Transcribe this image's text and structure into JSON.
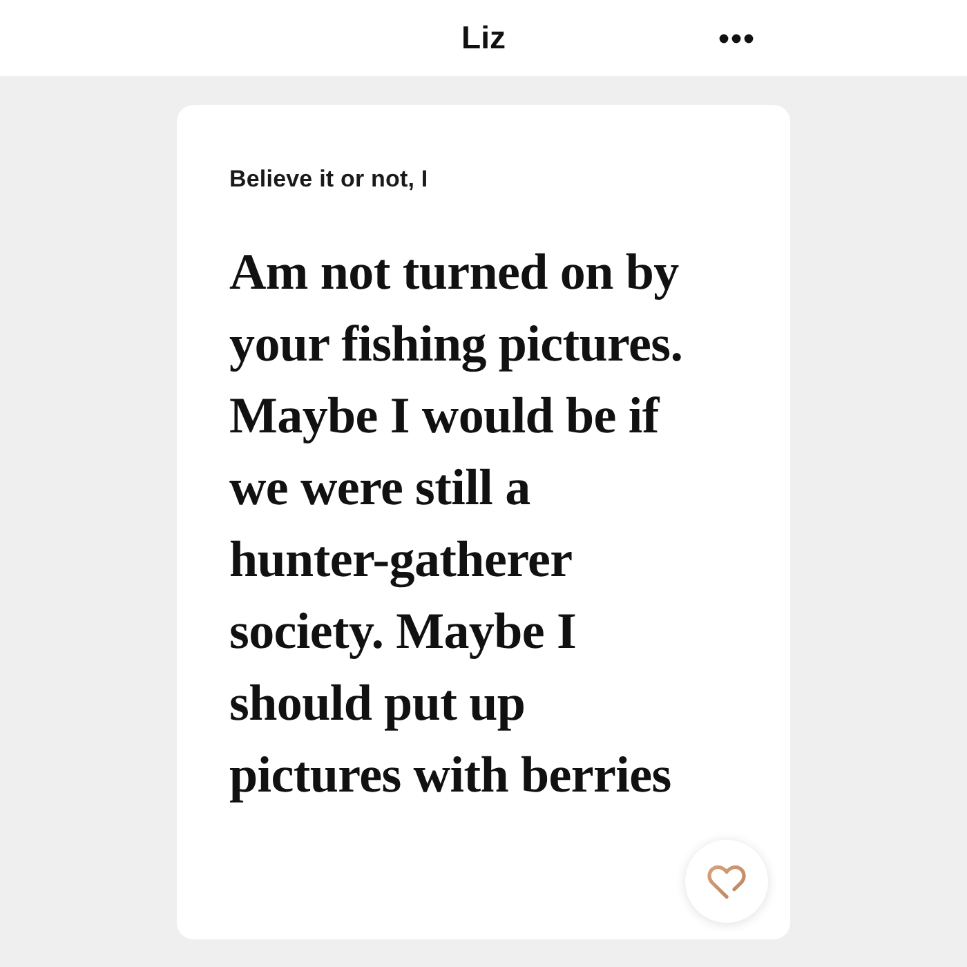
{
  "header": {
    "title": "Liz"
  },
  "prompt": {
    "question": "Believe it or not, I",
    "answer": "Am not turned on by\nyour fishing pictures.\nMaybe I would be if\nwe were still a\nhunter-gatherer\nsociety. Maybe I\nshould put up\npictures with berries"
  }
}
